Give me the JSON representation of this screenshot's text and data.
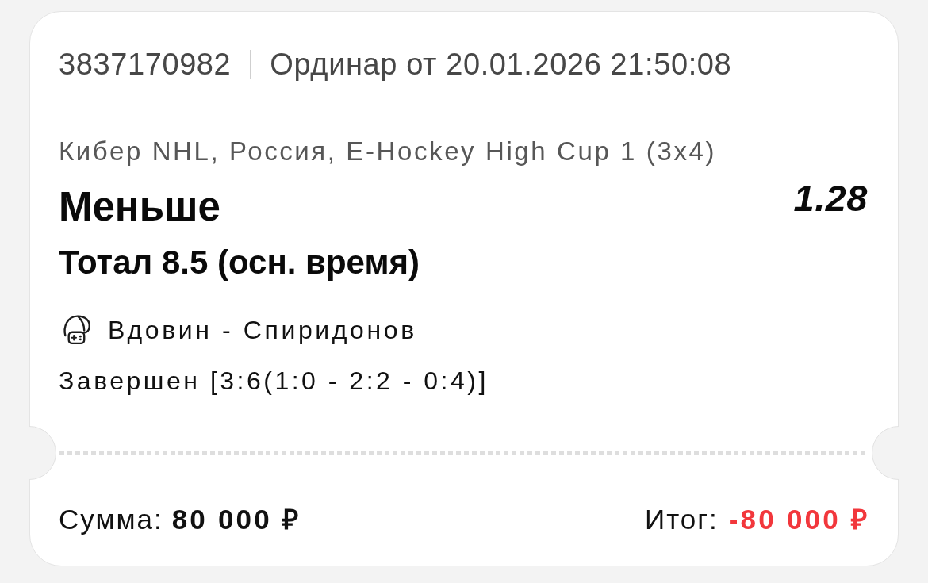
{
  "header": {
    "ticket_number": "3837170982",
    "bet_info": "Ординар от 20.01.2026 21:50:08"
  },
  "bet": {
    "event_path": "Кибер NHL, Россия, E-Hockey High Cup 1 (3x4)",
    "outcome": "Меньше",
    "odds": "1.28",
    "market": "Тотал 8.5 (осн. время)",
    "match": "Вдовин - Спиридонов",
    "status": "Завершен [3:6(1:0 - 2:2 - 0:4)]"
  },
  "footer": {
    "stake": {
      "label": "Сумма:",
      "value": "80 000 ₽"
    },
    "result": {
      "label": "Итог:",
      "value": "-80 000 ₽",
      "loss": true
    }
  }
}
